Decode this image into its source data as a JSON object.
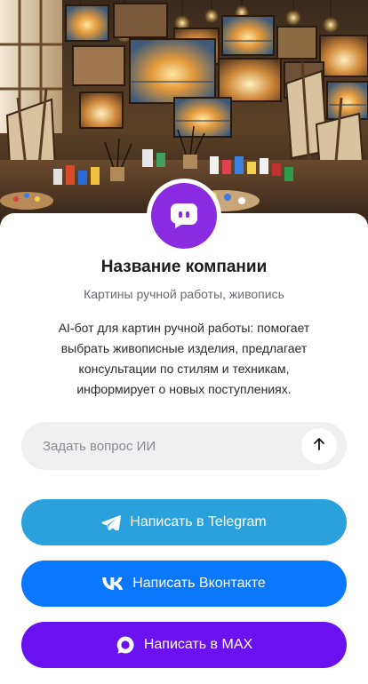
{
  "hero": {
    "image_alt": "artist studio with paintings and paint supplies"
  },
  "company": {
    "logo_icon": "chat-bot-icon",
    "name": "Название компании",
    "subtitle": "Картины ручной работы, живопись",
    "description": "AI-бот для картин ручной работы: помогает выбрать живописные изделия, предлагает консультации по стилям и техникам, информирует о новых поступлениях."
  },
  "ask": {
    "placeholder": "Задать вопрос ИИ",
    "value": "",
    "send_icon": "arrow-up-icon"
  },
  "buttons": {
    "telegram": {
      "label": "Написать в Telegram",
      "icon": "telegram-icon",
      "color": "#2aa1dd"
    },
    "vk": {
      "label": "Написать Вконтакте",
      "icon": "vk-icon",
      "color": "#0a77ff"
    },
    "max": {
      "label": "Написать в MAX",
      "icon": "max-icon",
      "color": "#6a11f0"
    }
  },
  "colors": {
    "accent": "#8a2be2"
  }
}
